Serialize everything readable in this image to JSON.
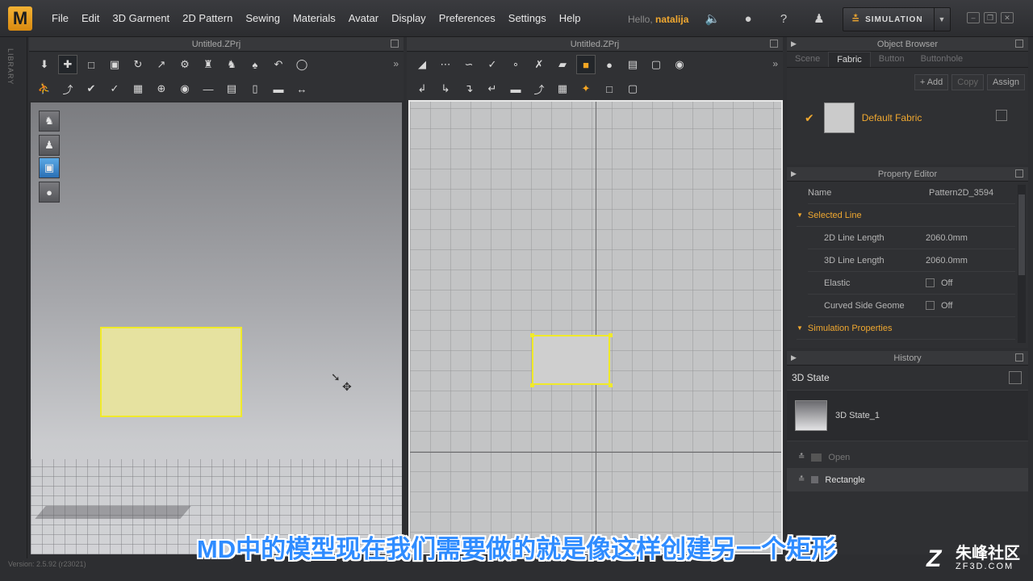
{
  "menu": {
    "logo": "M",
    "items": [
      "File",
      "Edit",
      "3D Garment",
      "2D Pattern",
      "Sewing",
      "Materials",
      "Avatar",
      "Display",
      "Preferences",
      "Settings",
      "Help"
    ],
    "hello": "Hello,",
    "user": "natalija",
    "simulation": "SIMULATION"
  },
  "library_label": "LIBRARY",
  "pane3d": {
    "title": "Untitled.ZPrj"
  },
  "pane2d": {
    "title": "Untitled.ZPrj"
  },
  "object_browser": {
    "title": "Object Browser",
    "tabs": [
      "Scene",
      "Fabric",
      "Button",
      "Buttonhole"
    ],
    "active_tab": "Fabric",
    "buttons": {
      "add": "+ Add",
      "copy": "Copy",
      "assign": "Assign"
    },
    "fabric": {
      "name": "Default Fabric"
    }
  },
  "property_editor": {
    "title": "Property Editor",
    "name_label": "Name",
    "name_value": "Pattern2D_3594",
    "selected_line": "Selected Line",
    "line2d_label": "2D Line Length",
    "line2d_value": "2060.0mm",
    "line3d_label": "3D Line Length",
    "line3d_value": "2060.0mm",
    "elastic_label": "Elastic",
    "elastic_value": "Off",
    "curved_label": "Curved Side Geome",
    "curved_value": "Off",
    "sim_props": "Simulation Properties"
  },
  "history": {
    "title": "History",
    "state_label": "3D State",
    "state_item": "3D State_1",
    "group_open": "Open",
    "group_rect": "Rectangle"
  },
  "status": "Version: 2.5.92   (r23021)",
  "subtitle": "MD中的模型现在我们需要做的就是像这样创建另一个矩形",
  "watermark": {
    "cn": "朱峰社区",
    "en": "ZF3D.COM"
  },
  "colors": {
    "accent": "#f0a830",
    "selection": "#f0ea2a"
  }
}
